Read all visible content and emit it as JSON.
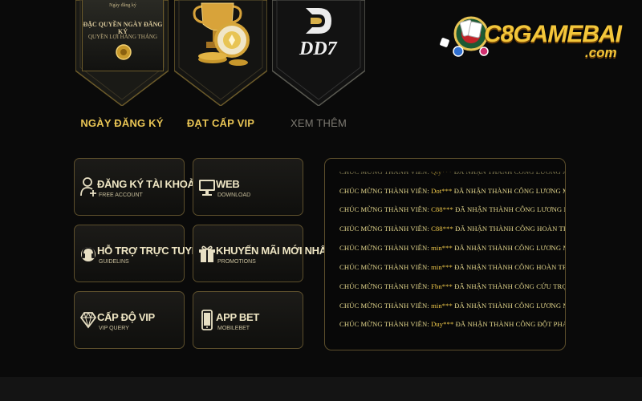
{
  "banners": [
    {
      "label": "NGÀY ĐĂNG KÝ",
      "card_title": "Ngày đăng ký",
      "card_line1": "ĐẶC QUYỀN NGÀY ĐĂNG KÝ",
      "card_line2": "QUYỀN LỢI HÀNG THÁNG"
    },
    {
      "label": "ĐẠT CẤP VIP"
    },
    {
      "label": "XEM THÊM",
      "card_text": "DD7"
    }
  ],
  "logo": {
    "text": "C8GAMEBAI",
    "sub": ".com"
  },
  "menu": [
    {
      "title": "ĐĂNG KÝ TÀI KHOẢN",
      "subtitle": "FREE ACCOUNT",
      "icon": "user-add-icon"
    },
    {
      "title": "WEB",
      "subtitle": "DOWNLOAD",
      "icon": "monitor-icon"
    },
    {
      "title": "HỖ TRỢ TRỰC TUYẾN",
      "subtitle": "GUIDELINS",
      "icon": "headset-icon"
    },
    {
      "title": "KHUYẾN MÃI MỚI NHẤT",
      "subtitle": "PROMOTIONS",
      "icon": "gift-icon"
    },
    {
      "title": "CẤP ĐỘ VIP",
      "subtitle": "VIP QUERY",
      "icon": "diamond-icon"
    },
    {
      "title": "APP BET",
      "subtitle": "MOBILEBET",
      "icon": "phone-icon"
    }
  ],
  "winners": [
    {
      "prefix": "CHÚC MỪNG THÀNH VIÊN: ",
      "name": "Qty***",
      "text": " ĐÃ NHẬN THÀNH CÔNG LƯƠNG MỖI TUẦN"
    },
    {
      "prefix": "CHÚC MỪNG THÀNH VIÊN: ",
      "name": "Dot***",
      "text": " ĐÃ NHẬN THÀNH CÔNG LƯƠNG MỖI TUẦN"
    },
    {
      "prefix": "CHÚC MỪNG THÀNH VIÊN: ",
      "name": "C88***",
      "text": " ĐÃ NHẬN THÀNH CÔNG LƯƠNG MỖI TUẦN"
    },
    {
      "prefix": "CHÚC MỪNG THÀNH VIÊN: ",
      "name": "C88***",
      "text": " ĐÃ NHẬN THÀNH CÔNG HOÀN TRẢ THÁNG MỚI"
    },
    {
      "prefix": "CHÚC MỪNG THÀNH VIÊN: ",
      "name": "min***",
      "text": " ĐÃ NHẬN THÀNH CÔNG LƯƠNG MỖI TUẦN"
    },
    {
      "prefix": "CHÚC MỪNG THÀNH VIÊN: ",
      "name": "min***",
      "text": " ĐÃ NHẬN THÀNH CÔNG HOÀN TRẢ THÁNG MỚI"
    },
    {
      "prefix": "CHÚC MỪNG THÀNH VIÊN: ",
      "name": "Fbn***",
      "text": " ĐÃ NHẬN THÀNH CÔNG CỨU TRỢ ĐIỆN TỬ"
    },
    {
      "prefix": "CHÚC MỪNG THÀNH VIÊN: ",
      "name": "min***",
      "text": " ĐÃ NHẬN THÀNH CÔNG LƯƠNG MỖI TUẦN"
    },
    {
      "prefix": "CHÚC MỪNG THÀNH VIÊN: ",
      "name": "Duy***",
      "text": " ĐÃ NHẬN THÀNH CÔNG ĐỘT PHÁ GAME BÀI"
    }
  ],
  "colors": {
    "gold": "#e8c454",
    "border": "#5d4f2c",
    "background": "#0a0a0a"
  }
}
